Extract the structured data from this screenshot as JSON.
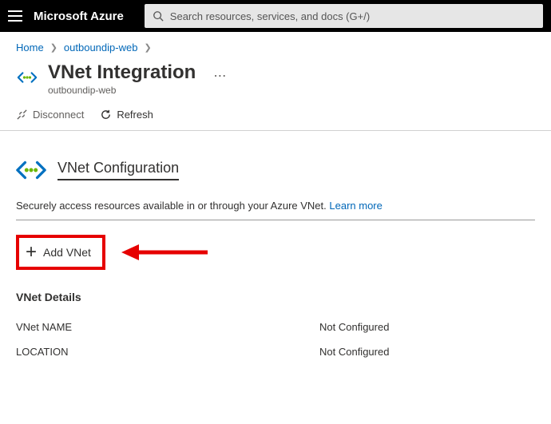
{
  "topbar": {
    "brand": "Microsoft Azure",
    "search_placeholder": "Search resources, services, and docs (G+/)"
  },
  "breadcrumb": {
    "home": "Home",
    "resource": "outboundip-web"
  },
  "header": {
    "title": "VNet Integration",
    "subtitle": "outboundip-web"
  },
  "toolbar": {
    "disconnect": "Disconnect",
    "refresh": "Refresh"
  },
  "config": {
    "section_title": "VNet Configuration",
    "description": "Securely access resources available in or through your Azure VNet.",
    "learn_more": "Learn more"
  },
  "add_vnet": {
    "label": "Add VNet"
  },
  "details": {
    "heading": "VNet Details",
    "rows": [
      {
        "label": "VNet NAME",
        "value": "Not Configured"
      },
      {
        "label": "LOCATION",
        "value": "Not Configured"
      }
    ]
  }
}
